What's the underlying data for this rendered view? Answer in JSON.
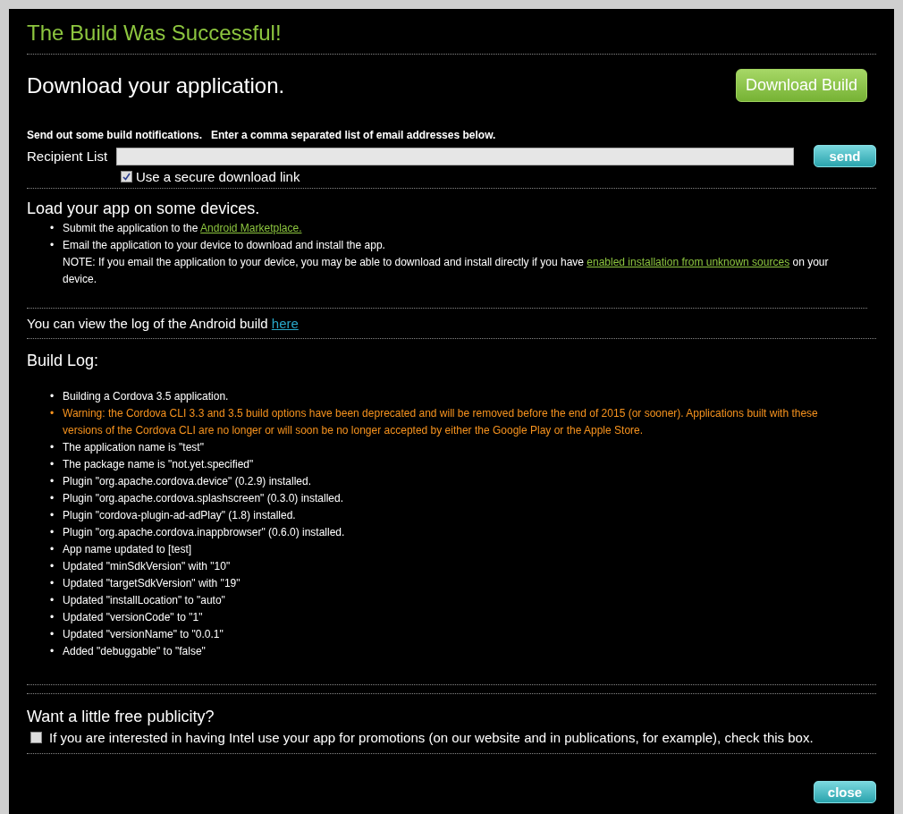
{
  "title": "The Build Was Successful!",
  "download": {
    "heading": "Download your application.",
    "button": "Download Build"
  },
  "notify": {
    "intro": "Send out some build notifications.   Enter a comma separated list of email addresses below.",
    "label": "Recipient List",
    "send": "send",
    "secure": {
      "label": "Use a secure download link",
      "checked": true
    }
  },
  "devices": {
    "heading": "Load your app on some devices.",
    "bullet": "•",
    "items": [
      {
        "before": "Submit the application to the ",
        "link": "Android Marketplace."
      },
      {
        "before": "Email the application to your device to download and install the app.",
        "note": {
          "before": "NOTE:  If you email the application to your device, you may be able to download and install directly if you have ",
          "link": "enabled installation from unknown sources",
          "after": " on your device."
        }
      }
    ]
  },
  "log_link": {
    "text": "You can view the log of the Android build ",
    "link": "here"
  },
  "build_log": {
    "heading": "Build Log:",
    "bullet": "•",
    "items": [
      {
        "kind": "info",
        "text": "Building a Cordova 3.5 application."
      },
      {
        "kind": "warning",
        "text": "Warning: the Cordova CLI 3.3 and 3.5 build options have been deprecated and will be removed before the end of 2015 (or sooner). Applications built with these versions of the Cordova CLI are no longer or will soon be no longer accepted by either the Google Play or the Apple Store."
      },
      {
        "kind": "info",
        "text": "The application name is \"test\""
      },
      {
        "kind": "info",
        "text": "The package name is \"not.yet.specified\""
      },
      {
        "kind": "info",
        "text": "Plugin \"org.apache.cordova.device\" (0.2.9) installed."
      },
      {
        "kind": "info",
        "text": "Plugin \"org.apache.cordova.splashscreen\" (0.3.0) installed."
      },
      {
        "kind": "info",
        "text": "Plugin \"cordova-plugin-ad-adPlay\" (1.8) installed."
      },
      {
        "kind": "info",
        "text": "Plugin \"org.apache.cordova.inappbrowser\" (0.6.0) installed."
      },
      {
        "kind": "info",
        "text": "App name updated to [test]"
      },
      {
        "kind": "info",
        "text": "Updated \"minSdkVersion\" with \"10\""
      },
      {
        "kind": "info",
        "text": "Updated \"targetSdkVersion\" with \"19\""
      },
      {
        "kind": "info",
        "text": "Updated \"installLocation\" to \"auto\""
      },
      {
        "kind": "info",
        "text": "Updated \"versionCode\" to \"1\""
      },
      {
        "kind": "info",
        "text": "Updated \"versionName\" to \"0.0.1\""
      },
      {
        "kind": "info",
        "text": "Added \"debuggable\" to \"false\""
      }
    ]
  },
  "publicity": {
    "heading": "Want a little free publicity?",
    "label": "If you are interested in having Intel use your app for promotions (on our website and in publications, for example), check this box.",
    "checked": false
  },
  "close": "close"
}
